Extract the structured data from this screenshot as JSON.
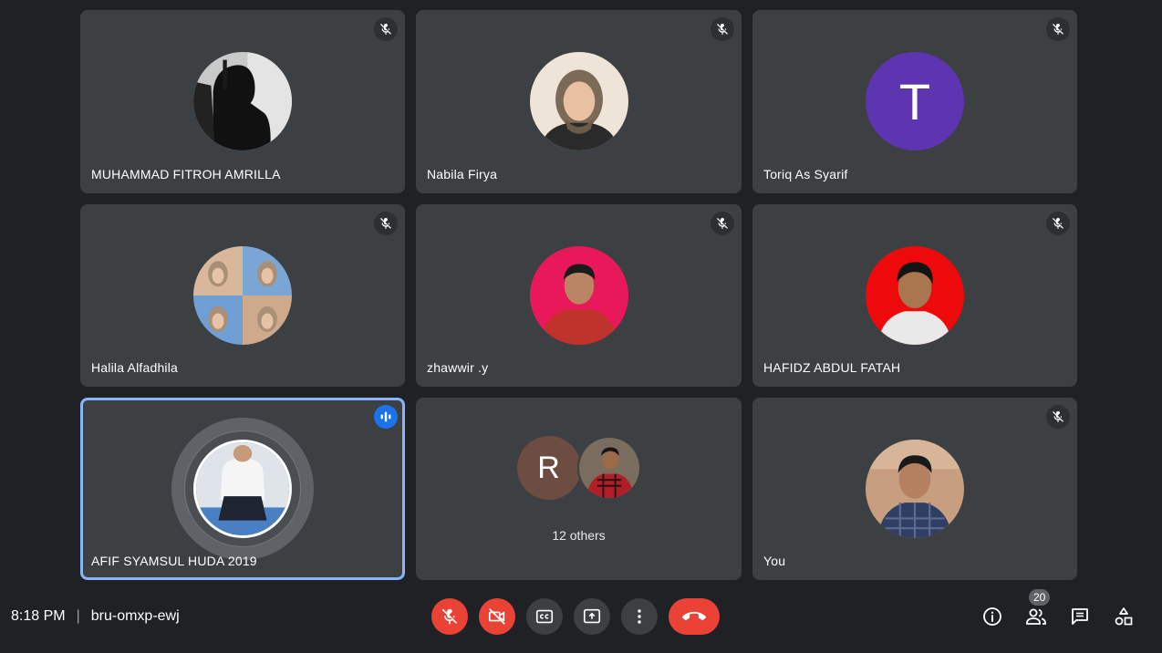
{
  "participants": [
    {
      "name": "MUHAMMAD FITROH AMRILLA",
      "muted": true
    },
    {
      "name": "Nabila Firya",
      "muted": true
    },
    {
      "name": "Toriq As Syarif",
      "muted": true,
      "initial": "T"
    },
    {
      "name": "Halila Alfadhila",
      "muted": true
    },
    {
      "name": "zhawwir .y",
      "muted": true
    },
    {
      "name": "HAFIDZ ABDUL FATAH",
      "muted": true
    },
    {
      "name": "AFIF SYAMSUL HUDA 2019",
      "muted": false,
      "speaking": true
    },
    {
      "initial": "R",
      "others_label": "12 others"
    },
    {
      "name": "You",
      "muted": true
    }
  ],
  "meeting": {
    "time": "8:18 PM",
    "separator": "|",
    "code": "bru-omxp-ewj"
  },
  "controls": {
    "mic": "mic-off-icon",
    "camera": "camera-off-icon",
    "captions": "captions-icon",
    "present": "present-screen-icon",
    "more": "more-vert-icon",
    "end": "call-end-icon"
  },
  "side_panel": {
    "people_count": "20"
  },
  "colors": {
    "background": "#202124",
    "tile": "#3c4043",
    "danger": "#ea4335",
    "speaking_border": "#8ab4f8",
    "speaking_badge": "#1a73e8",
    "toriq_avatar": "#5e35b1",
    "r_avatar": "#6d4c41"
  }
}
